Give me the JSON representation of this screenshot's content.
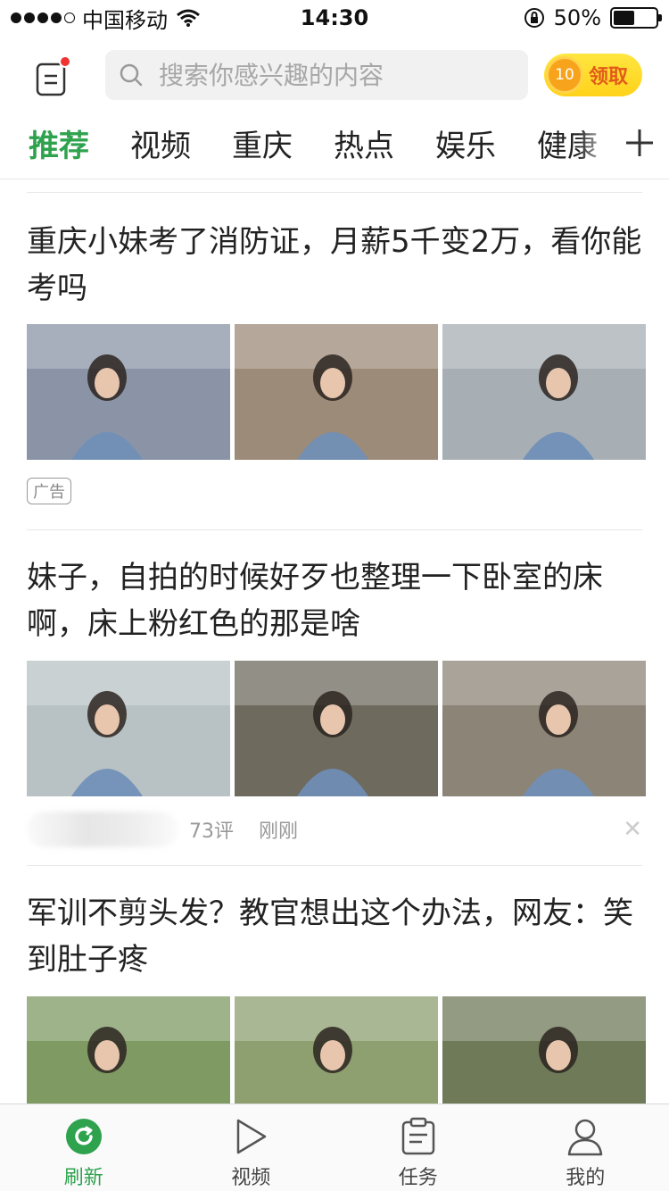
{
  "status_bar": {
    "carrier": "中国移动",
    "time": "14:30",
    "battery_text": "50%",
    "battery_level": 0.5
  },
  "header": {
    "search_placeholder": "搜索你感兴趣的内容",
    "coin_amount": "10",
    "coin_label": "领取",
    "has_unread": true
  },
  "tabs": [
    {
      "label": "推荐",
      "active": true
    },
    {
      "label": "视频",
      "active": false
    },
    {
      "label": "重庆",
      "active": false
    },
    {
      "label": "热点",
      "active": false
    },
    {
      "label": "娱乐",
      "active": false
    },
    {
      "label": "健康",
      "active": false
    }
  ],
  "feed": [
    {
      "title": "重庆小妹考了消防证，月薪5千变2万，看你能考吗",
      "ad_tag": "广告",
      "thumb_colors": [
        "#8a94a6",
        "#9c8b78",
        "#a7aeb4"
      ]
    },
    {
      "title": "妹子，自拍的时候好歹也整理一下卧室的床啊，床上粉红色的那是啥",
      "comments": "73评",
      "time": "刚刚",
      "thumb_colors": [
        "#b8c2c4",
        "#6e6a5e",
        "#8d8478"
      ]
    },
    {
      "title": "军训不剪头发？教官想出这个办法，网友：笑到肚子疼",
      "thumb_colors": [
        "#7f9a63",
        "#8e9f70",
        "#6f7a58"
      ]
    }
  ],
  "bottom_nav": [
    {
      "label": "刷新",
      "icon": "refresh-icon",
      "active": true
    },
    {
      "label": "视频",
      "icon": "play-icon",
      "active": false
    },
    {
      "label": "任务",
      "icon": "clipboard-icon",
      "active": false
    },
    {
      "label": "我的",
      "icon": "user-icon",
      "active": false
    }
  ],
  "colors": {
    "accent": "#2fa24d",
    "coin_bg": "#ffd21a",
    "unread_dot": "#f03232"
  }
}
